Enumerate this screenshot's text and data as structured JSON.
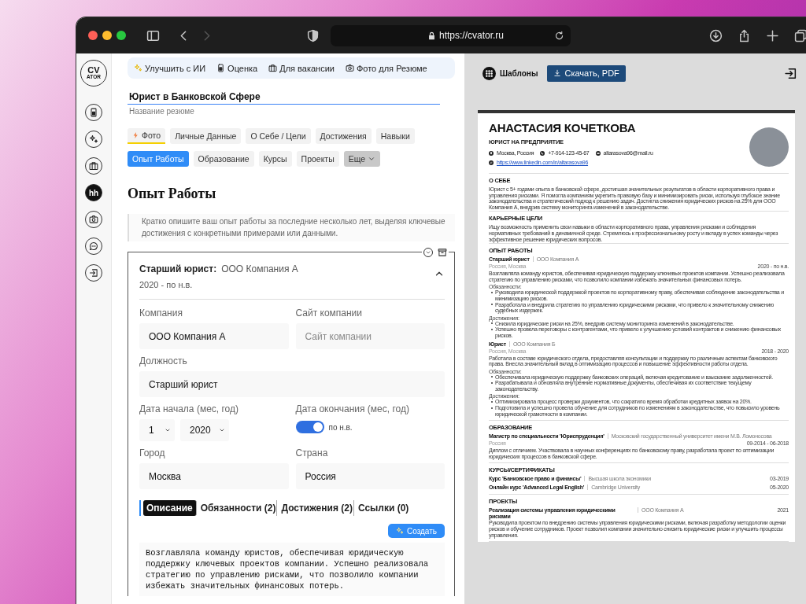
{
  "browser": {
    "url": "https://cvator.ru",
    "forward_disabled": true
  },
  "sidebar": {
    "logo_top": "CV",
    "logo_bottom": "ATOR",
    "items": [
      {
        "kind": "rating",
        "selected": false
      },
      {
        "kind": "sparkle",
        "selected": false
      },
      {
        "kind": "briefcase",
        "selected": false
      },
      {
        "kind": "hh",
        "label": "hh",
        "selected": true
      },
      {
        "kind": "camera",
        "selected": false
      },
      {
        "kind": "chat",
        "selected": false
      },
      {
        "kind": "logout",
        "selected": false
      }
    ]
  },
  "toolbar": [
    {
      "kind": "sparkle",
      "label": "Улучшить с ИИ"
    },
    {
      "kind": "rating",
      "label": "Оценка"
    },
    {
      "kind": "briefcase",
      "label": "Для вакансии"
    },
    {
      "kind": "camera",
      "label": "Фото для Резюме"
    }
  ],
  "resume_title": {
    "value": "Юрист в Банковской Сфере",
    "label": "Название резюме"
  },
  "tabs": [
    {
      "label": "Фото",
      "selected": false,
      "flagged": true
    },
    {
      "label": "Личные Данные",
      "selected": false,
      "flagged": false
    },
    {
      "label": "О Себе / Цели",
      "selected": false,
      "flagged": false
    },
    {
      "label": "Достижения",
      "selected": false,
      "flagged": false
    },
    {
      "label": "Навыки",
      "selected": false,
      "flagged": false
    },
    {
      "label": "Опыт Работы",
      "selected": true,
      "flagged": false
    },
    {
      "label": "Образование",
      "selected": false,
      "flagged": false
    },
    {
      "label": "Курсы",
      "selected": false,
      "flagged": false
    },
    {
      "label": "Проекты",
      "selected": false,
      "flagged": false
    },
    {
      "label": "Еще",
      "selected": false,
      "flagged": false,
      "kind": "dropdown"
    }
  ],
  "section_title": "Опыт Работы",
  "hint": "Кратко опишите ваш опыт работы за последние несколько лет, выделяя ключевые достижения с конкретными примерами или данными.",
  "entry": {
    "position": "Старший юрист:",
    "company": "ООО Компания А",
    "dates": "2020 - по н.в.",
    "expanded": true,
    "fields": [
      {
        "kind": "text",
        "label": "Компания",
        "value": "ООО Компания А"
      },
      {
        "kind": "text",
        "label": "Сайт компании",
        "placeholder": "Сайт компании"
      },
      {
        "kind": "text",
        "label": "Должность",
        "value": "Старший юрист",
        "wide": true
      },
      {
        "kind": "date",
        "label": "Дата начала (мес, год)",
        "month": "1",
        "year": "2020"
      },
      {
        "kind": "toggle",
        "label": "Дата окончания (мес, год)",
        "on": true,
        "text": "по н.в."
      },
      {
        "kind": "text",
        "label": "Город",
        "value": "Москва"
      },
      {
        "kind": "text",
        "label": "Страна",
        "value": "Россия"
      }
    ],
    "subtabs": [
      {
        "label": "Описание",
        "selected": true
      },
      {
        "label": "Обязанности (2)",
        "selected": false
      },
      {
        "label": "Достижения (2)",
        "selected": false
      },
      {
        "label": "Ссылки (0)",
        "selected": false
      }
    ],
    "create_button": "Создать",
    "description": "Возглавляла команду юристов, обеспечивая юридическую поддержку ключевых проектов компании. Успешно реализовала стратегию по управлению рисками, что позволило компании избежать значительных финансовых потерь."
  },
  "preview": {
    "templates_button": "Шаблоны",
    "download_button": "Скачать, PDF"
  },
  "resume": {
    "name": "АНАСТАСИЯ КОЧЕТКОВА",
    "headline": "ЮРИСТ НА ПРЕДПРИЯТИЕ",
    "contacts": [
      {
        "kind": "location",
        "text": "Москва, Россия"
      },
      {
        "kind": "phone",
        "text": "+7-914-123-45-67"
      },
      {
        "kind": "email",
        "text": "altarasova96@mail.ru"
      },
      {
        "kind": "link",
        "text": "https://www.linkedin.com/in/altarasova96"
      }
    ],
    "sections": [
      {
        "kind": "text",
        "title": "О СЕБЕ",
        "text": "Юрист с 5+ годами опыта в банковской сфере, достигшая значительных результатов в области корпоративного права и управления рисками. Я помогла компаниям укрепить правовую базу и минимизировать риски, используя глубокое знание законодательства и стратегический подход к решению задач. Достигла снижения юридических рисков на 25% для ООО Компания А, внедрив систему мониторинга изменений в законодательстве."
      },
      {
        "kind": "text",
        "title": "КАРЬЕРНЫЕ ЦЕЛИ",
        "text": "Ищу возможность применить свои навыки в области корпоративного права, управления рисками и соблюдения нормативных требований в динамичной среде. Стремлюсь к профессиональному росту и вкладу в успех команды через эффективное решение юридических вопросов."
      },
      {
        "kind": "entries",
        "title": "ОПЫТ РАБОТЫ",
        "entries": [
          {
            "title": "Старший юрист",
            "org": "ООО Компания А",
            "date": "2020 - по н.в.",
            "location": "Россия, Москва",
            "description": "Возглавляла команду юристов, обеспечивая юридическую поддержку ключевых проектов компании. Успешно реализовала стратегию по управлению рисками, что позволило компании избежать значительных финансовых потерь.",
            "groups": [
              {
                "label": "Обязанности:",
                "items": [
                  "Руководила юридической поддержкой проектов по корпоративному праву, обеспечивая соблюдение законодательства и минимизацию рисков.",
                  "Разработала и внедрила стратегию по управлению юридическими рисками, что привело к значительному снижению судебных издержек."
                ]
              },
              {
                "label": "Достижения:",
                "items": [
                  "Снизила юридические риски на 25%, внедрив систему мониторинга изменений в законодательстве.",
                  "Успешно провела переговоры с контрагентами, что привело к улучшению условий контрактов и снижению финансовых рисков."
                ]
              }
            ]
          },
          {
            "title": "Юрист",
            "org": "ООО Компания Б",
            "date": "2018 - 2020",
            "location": "Россия, Москва",
            "description": "Работала в составе юридического отдела, предоставляя консультации и поддержку по различным аспектам банковского права. Внесла значительный вклад в оптимизацию процессов и повышение эффективности работы отдела.",
            "groups": [
              {
                "label": "Обязанности:",
                "items": [
                  "Обеспечивала юридическую поддержку банковских операций, включая кредитование и взыскание задолженностей.",
                  "Разрабатывала и обновляла внутренние нормативные документы, обеспечивая их соответствие текущему законодательству."
                ]
              },
              {
                "label": "Достижения:",
                "items": [
                  "Оптимизировала процесс проверки документов, что сократило время обработки кредитных заявок на 20%.",
                  "Подготовила и успешно провела обучение для сотрудников по изменениям в законодательстве, что повысило уровень юридической грамотности в компании."
                ]
              }
            ]
          }
        ]
      },
      {
        "kind": "entries",
        "title": "ОБРАЗОВАНИЕ",
        "entries": [
          {
            "title": "Магистр по специальности 'Юриспруденция'",
            "org": "Московский государственный университет имени М.В. Ломоносова",
            "location": "Россия",
            "date": "09-2014 - 06-2018",
            "description": "Диплом с отличием. Участвовала в научных конференциях по банковскому праву, разработала проект по оптимизации юридических процессов в банковской сфере."
          }
        ]
      },
      {
        "kind": "entries",
        "title": "КУРСЫ/СЕРТИФИКАТЫ",
        "entries": [
          {
            "title": "Курс 'Банковское право и финансы'",
            "org": "Высшая школа экономики",
            "date": "03-2019"
          },
          {
            "title": "Онлайн курс 'Advanced Legal English'",
            "org": "Cambridge University",
            "date": "05-2020"
          }
        ]
      },
      {
        "kind": "entries",
        "title": "ПРОЕКТЫ",
        "entries": [
          {
            "title": "Реализация системы управления юридическими рисками",
            "org": "ООО Компания А",
            "date": "2021",
            "description": "Руководила проектом по внедрению системы управления юридическими рисками, включая разработку методологии оценки рисков и обучение сотрудников. Проект позволил компании значительно снизить юридические риски и улучшить процессы управления."
          }
        ]
      }
    ]
  }
}
